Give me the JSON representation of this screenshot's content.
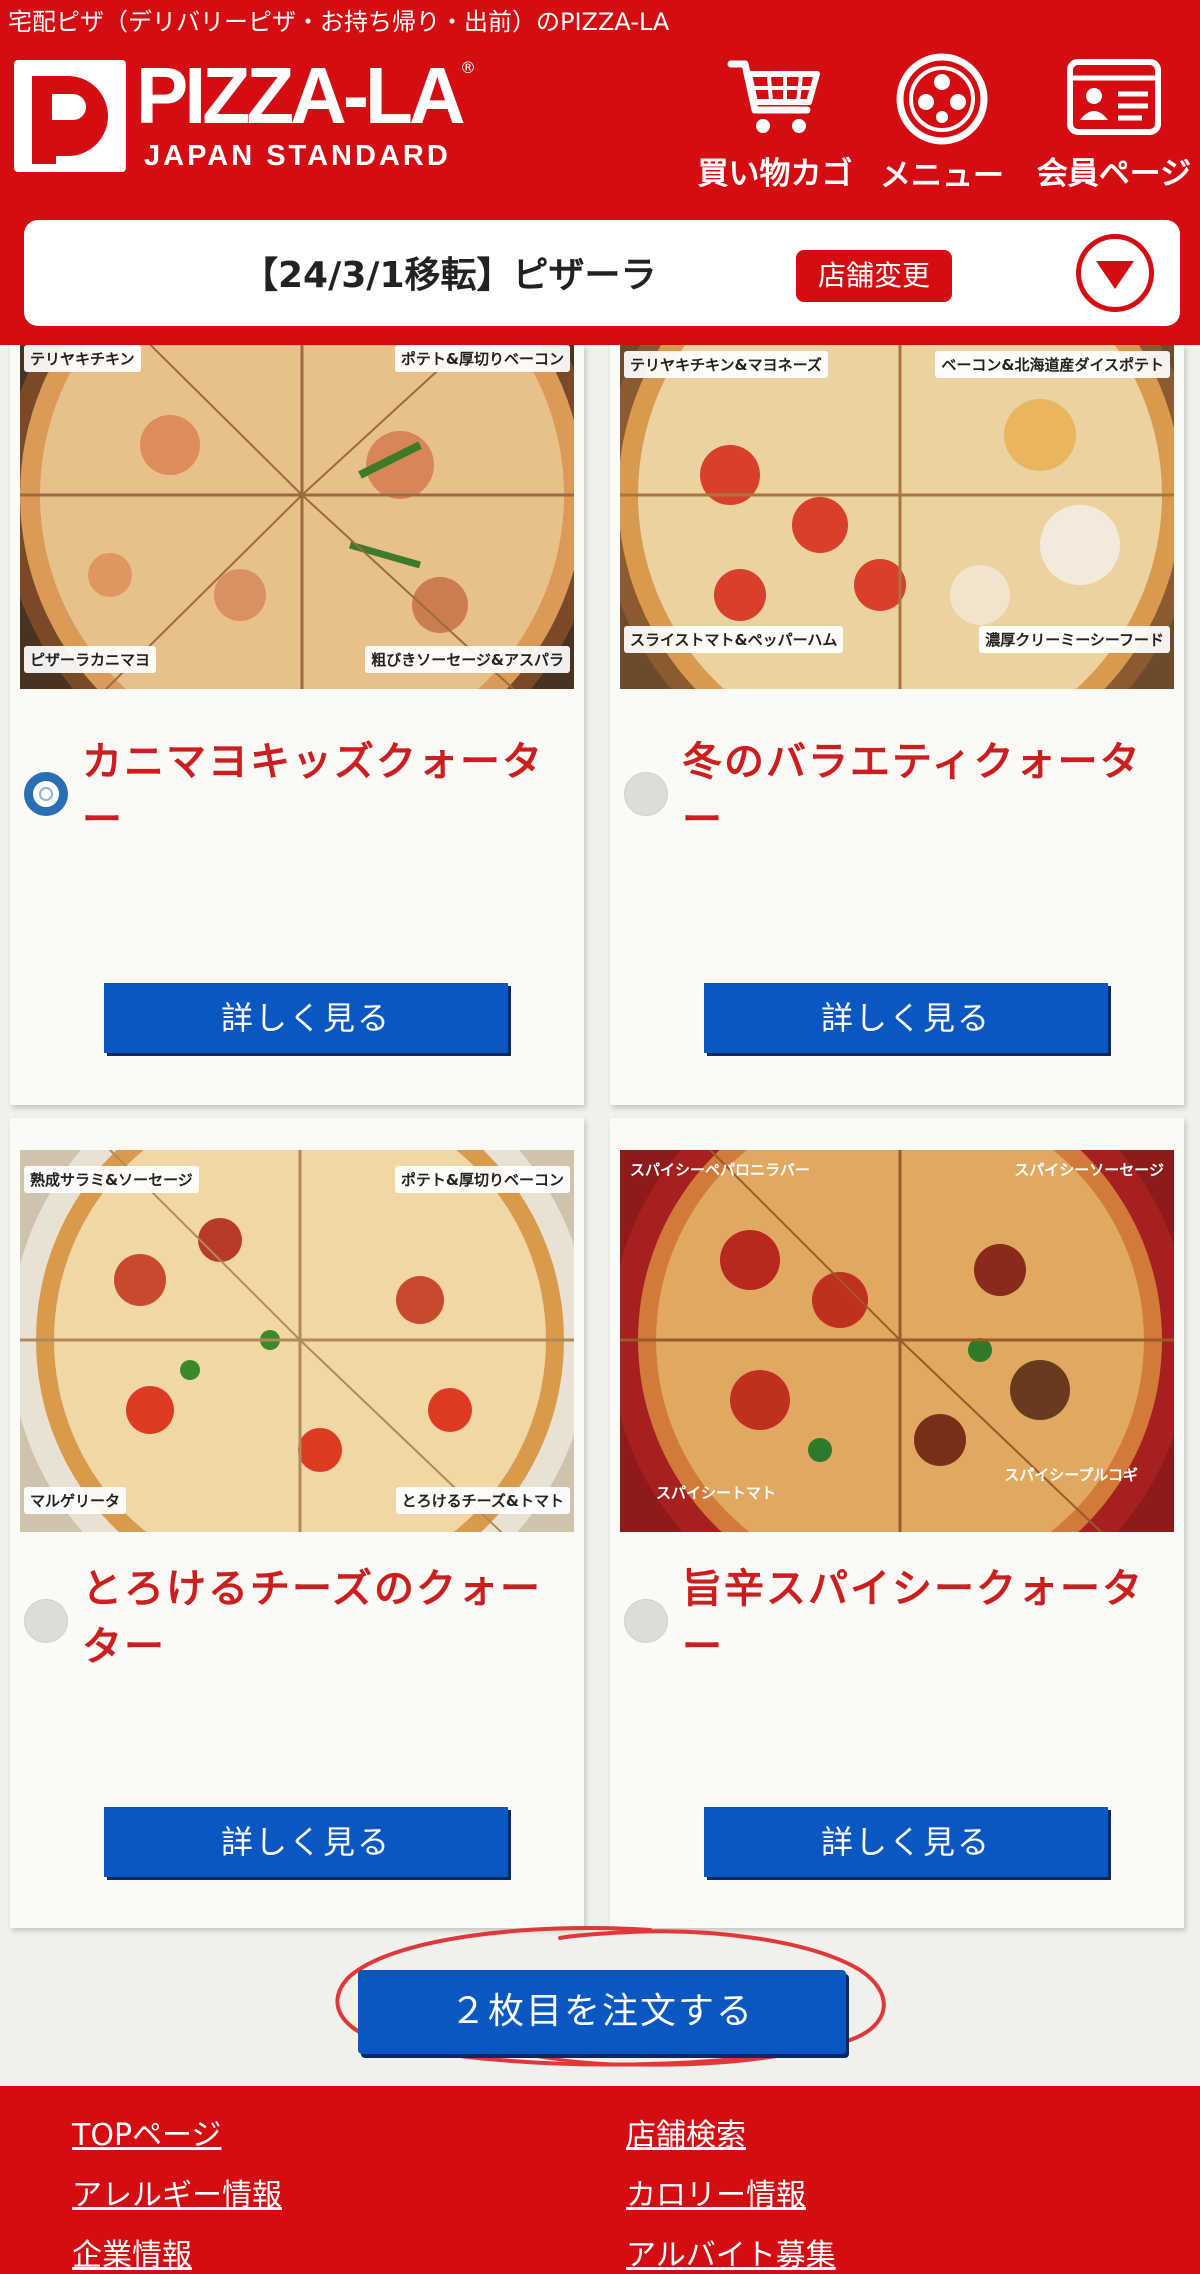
{
  "header": {
    "tagline": "宅配ピザ（デリバリーピザ・お持ち帰り・出前）のPIZZA-LA",
    "logo_text": "PIZZA-LA",
    "logo_sub": "JAPAN STANDARD",
    "nav": [
      {
        "label": "買い物カゴ",
        "icon": "cart-icon"
      },
      {
        "label": "メニュー",
        "icon": "pizza-icon"
      },
      {
        "label": "会員ページ",
        "icon": "member-card-icon"
      }
    ]
  },
  "store": {
    "name": "【24/3/1移転】ピザーラ",
    "change_label": "店舗変更"
  },
  "products": [
    {
      "name": "カニマヨキッズクォーター",
      "selected": true,
      "detail_label": "詳しく見る",
      "tags": [
        "テリヤキチキン",
        "ポテト&厚切りベーコン",
        "ピザーラカニマヨ",
        "粗びきソーセージ&アスパラ"
      ]
    },
    {
      "name": "冬のバラエティクォーター",
      "selected": false,
      "detail_label": "詳しく見る",
      "tags": [
        "テリヤキチキン&マヨネーズ",
        "ベーコン&北海道産ダイスポテト",
        "スライストマト&ペッパーハム",
        "濃厚クリーミーシーフード"
      ]
    },
    {
      "name": "とろけるチーズのクォーター",
      "selected": false,
      "detail_label": "詳しく見る",
      "tags": [
        "熟成サラミ&ソーセージ",
        "ポテト&厚切りベーコン",
        "マルゲリータ",
        "とろけるチーズ&トマト"
      ]
    },
    {
      "name": "旨辛スパイシークォーター",
      "selected": false,
      "detail_label": "詳しく見る",
      "tags": [
        "スパイシーペパロニラバー",
        "スパイシーソーセージ",
        "スパイシートマト",
        "スパイシープルコギ"
      ]
    }
  ],
  "order_button_label": "２枚目を注文する",
  "footer": {
    "links": [
      "TOPページ",
      "店舗検索",
      "アレルギー情報",
      "カロリー情報",
      "企業情報",
      "アルバイト募集"
    ]
  },
  "colors": {
    "brand_red": "#d40d12",
    "button_blue": "#0b57c2",
    "product_name_red": "#cc1e1e"
  }
}
